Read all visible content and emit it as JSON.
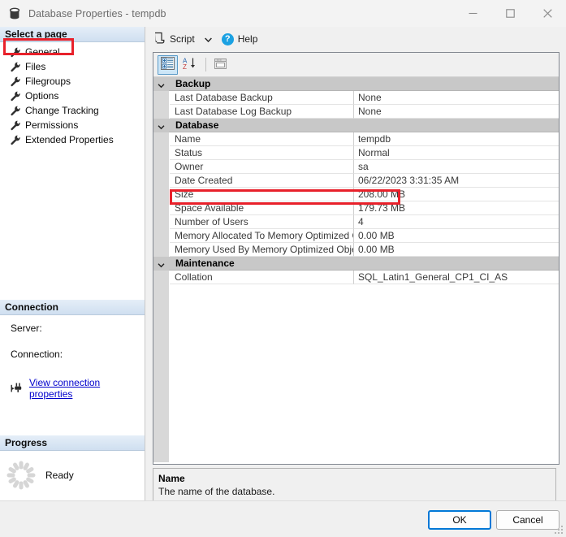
{
  "window": {
    "title": "Database Properties - tempdb",
    "icon": "database-icon",
    "minimize": "minimize",
    "maximize": "maximize",
    "close": "close"
  },
  "sidebar": {
    "header": "Select a page",
    "items": [
      {
        "label": "General",
        "icon": "wrench-icon",
        "selected": true
      },
      {
        "label": "Files",
        "icon": "wrench-icon",
        "selected": false
      },
      {
        "label": "Filegroups",
        "icon": "wrench-icon",
        "selected": false
      },
      {
        "label": "Options",
        "icon": "wrench-icon",
        "selected": false
      },
      {
        "label": "Change Tracking",
        "icon": "wrench-icon",
        "selected": false
      },
      {
        "label": "Permissions",
        "icon": "wrench-icon",
        "selected": false
      },
      {
        "label": "Extended Properties",
        "icon": "wrench-icon",
        "selected": false
      }
    ],
    "connection": {
      "header": "Connection",
      "server_label": "Server:",
      "server_value": "",
      "connection_label": "Connection:",
      "connection_value": "",
      "link": "View connection properties",
      "link_icon": "plug-icon"
    },
    "progress": {
      "header": "Progress",
      "status": "Ready",
      "spinner_icon": "spinner-icon"
    }
  },
  "toolbar": {
    "script_label": "Script",
    "script_icon": "script-icon",
    "dropdown_icon": "chevron-down-icon",
    "help_label": "Help",
    "help_icon": "help-icon"
  },
  "grid_toolbar": {
    "categorized_label": "Categorized",
    "categorized_icon": "categorized-view-icon",
    "alphabetic_label": "Alphabetical",
    "alphabetic_icon": "sort-az-icon",
    "pages_label": "Property Pages",
    "pages_icon": "property-pages-icon"
  },
  "grid": {
    "categories": [
      {
        "name": "Backup",
        "expanded": true,
        "rows": [
          {
            "name": "Last Database Backup",
            "value": "None"
          },
          {
            "name": "Last Database Log Backup",
            "value": "None"
          }
        ]
      },
      {
        "name": "Database",
        "expanded": true,
        "rows": [
          {
            "name": "Name",
            "value": "tempdb"
          },
          {
            "name": "Status",
            "value": "Normal"
          },
          {
            "name": "Owner",
            "value": "sa"
          },
          {
            "name": "Date Created",
            "value": "06/22/2023 3:31:35 AM"
          },
          {
            "name": "Size",
            "value": "208.00 MB",
            "highlighted": true
          },
          {
            "name": "Space Available",
            "value": "179.73 MB"
          },
          {
            "name": "Number of Users",
            "value": "4"
          },
          {
            "name": "Memory Allocated To Memory Optimized Objects",
            "value": "0.00 MB"
          },
          {
            "name": "Memory Used By Memory Optimized Objects",
            "value": "0.00 MB"
          }
        ]
      },
      {
        "name": "Maintenance",
        "expanded": true,
        "rows": [
          {
            "name": "Collation",
            "value": "SQL_Latin1_General_CP1_CI_AS"
          }
        ]
      }
    ]
  },
  "description": {
    "title": "Name",
    "text": "The name of the database."
  },
  "footer": {
    "ok_label": "OK",
    "cancel_label": "Cancel"
  },
  "annotations": {
    "highlight_color": "#e8212b"
  }
}
